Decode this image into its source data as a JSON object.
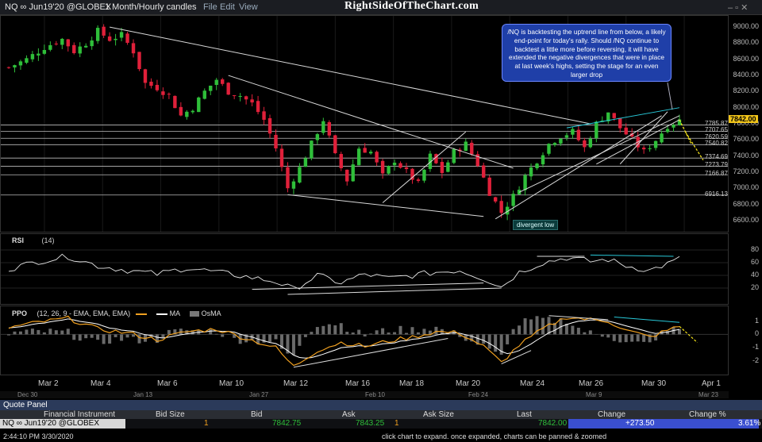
{
  "window": {
    "title": "NQ ∞ Jun19'20 @GLOBEX",
    "interval": "1 Month/Hourly candles",
    "menu": [
      "File",
      "Edit",
      "View"
    ],
    "watermark": "RightSideOfTheChart.com"
  },
  "callout": "/NQ is backtesting the uptrend line from below, a likely end-point for today's rally. Should /NQ continue to backtest a little more before reversing, it will have extended the negative divergences that were in place at last week's highs, setting the stage for an even larger drop",
  "annotation": "divergent low",
  "price_axis": [
    "9000.00",
    "8800.00",
    "8600.00",
    "8400.00",
    "8200.00",
    "8000.00",
    "7800.00",
    "7600.00",
    "7400.00",
    "7200.00",
    "7000.00",
    "6800.00",
    "6600.00"
  ],
  "levels": [
    "7785.87",
    "7707.65",
    "7620.59",
    "7540.82",
    "7374.69",
    "7273.79",
    "7166.87",
    "6916.13"
  ],
  "current_price": "7842.00",
  "rsi": {
    "label": "RSI",
    "param": "(14)",
    "axis": [
      "80",
      "60",
      "40",
      "20"
    ]
  },
  "ppo": {
    "label": "PPO",
    "param": "(12, 26, 9 - EMA, EMA, EMA)",
    "ma_label": "MA",
    "osma_label": "OsMA",
    "axis": [
      "1",
      "0",
      "-1",
      "-2"
    ]
  },
  "x_axis": [
    "Mar 2",
    "Mar 4",
    "Mar 6",
    "Mar 10",
    "Mar 12",
    "Mar 16",
    "Mar 18",
    "Mar 20",
    "Mar 24",
    "Mar 26",
    "Mar 30",
    "Apr 1"
  ],
  "date_bar": [
    "Dec 30",
    "Jan 13",
    "Jan 27",
    "Feb 10",
    "Feb 24",
    "Mar 9",
    "Mar 23"
  ],
  "quote_panel": {
    "title": "Quote Panel",
    "columns": [
      "Financial Instrument",
      "Bid Size",
      "Bid",
      "Ask",
      "Ask Size",
      "Last",
      "Change",
      "Change %"
    ],
    "row": {
      "instrument": "NQ ∞ Jun19'20 @GLOBEX",
      "bid_size": "1",
      "bid": "7842.75",
      "ask": "7843.25",
      "ask_size": "1",
      "last": "7842.00",
      "change": "+273.50",
      "change_pct": "3.61%"
    }
  },
  "status": {
    "time": "2:44:10 PM 3/30/2020",
    "hint": "click chart to expand. once expanded, charts can be panned & zoomed"
  },
  "colors": {
    "up": "#2fbf3a",
    "down": "#e0203a",
    "ppo": "#f0a020",
    "signal": "#ffffff",
    "trend": "#d8d8d8",
    "cyan": "#28c8d8",
    "yellow": "#f3e21a",
    "price_box": "#f0c419"
  },
  "chart_data": {
    "type": "candlestick",
    "ylim": [
      6500,
      9100
    ],
    "close_path": [
      [
        0,
        8500
      ],
      [
        3,
        8600
      ],
      [
        6,
        8750
      ],
      [
        9,
        8850
      ],
      [
        11,
        8700
      ],
      [
        13,
        8800
      ],
      [
        15,
        8950
      ],
      [
        17,
        8850
      ],
      [
        19,
        8900
      ],
      [
        21,
        8700
      ],
      [
        23,
        8300
      ],
      [
        25,
        8250
      ],
      [
        27,
        8150
      ],
      [
        29,
        7900
      ],
      [
        31,
        8000
      ],
      [
        33,
        8200
      ],
      [
        35,
        8350
      ],
      [
        37,
        8200
      ],
      [
        39,
        8150
      ],
      [
        41,
        8050
      ],
      [
        43,
        7850
      ],
      [
        45,
        7500
      ],
      [
        47,
        7000
      ],
      [
        49,
        7250
      ],
      [
        51,
        7550
      ],
      [
        53,
        7850
      ],
      [
        55,
        7400
      ],
      [
        57,
        7100
      ],
      [
        59,
        7500
      ],
      [
        61,
        7450
      ],
      [
        63,
        7150
      ],
      [
        65,
        7350
      ],
      [
        67,
        7200
      ],
      [
        69,
        7050
      ],
      [
        71,
        7400
      ],
      [
        73,
        7200
      ],
      [
        75,
        7450
      ],
      [
        77,
        7550
      ],
      [
        79,
        7300
      ],
      [
        81,
        6950
      ],
      [
        83,
        6700
      ],
      [
        85,
        6900
      ],
      [
        87,
        7150
      ],
      [
        89,
        7350
      ],
      [
        91,
        7550
      ],
      [
        93,
        7650
      ],
      [
        95,
        7700
      ],
      [
        97,
        7500
      ],
      [
        99,
        7800
      ],
      [
        101,
        7950
      ],
      [
        103,
        7750
      ],
      [
        105,
        7600
      ],
      [
        107,
        7450
      ],
      [
        109,
        7600
      ],
      [
        111,
        7780
      ],
      [
        113,
        7842
      ]
    ],
    "rsi_path": [
      [
        0,
        50
      ],
      [
        5,
        62
      ],
      [
        10,
        70
      ],
      [
        15,
        55
      ],
      [
        20,
        48
      ],
      [
        25,
        42
      ],
      [
        30,
        52
      ],
      [
        35,
        45
      ],
      [
        40,
        38
      ],
      [
        45,
        30
      ],
      [
        48,
        18
      ],
      [
        52,
        40
      ],
      [
        56,
        28
      ],
      [
        60,
        42
      ],
      [
        64,
        35
      ],
      [
        68,
        40
      ],
      [
        72,
        45
      ],
      [
        76,
        48
      ],
      [
        80,
        35
      ],
      [
        83,
        22
      ],
      [
        86,
        45
      ],
      [
        90,
        60
      ],
      [
        94,
        68
      ],
      [
        98,
        62
      ],
      [
        101,
        65
      ],
      [
        104,
        55
      ],
      [
        108,
        48
      ],
      [
        111,
        58
      ],
      [
        113,
        66
      ]
    ],
    "ppo_path": [
      [
        0,
        0.5
      ],
      [
        5,
        0.9
      ],
      [
        10,
        1.2
      ],
      [
        15,
        0.4
      ],
      [
        20,
        0.1
      ],
      [
        25,
        -0.4
      ],
      [
        30,
        0.2
      ],
      [
        35,
        0.4
      ],
      [
        40,
        -0.3
      ],
      [
        45,
        -1.0
      ],
      [
        48,
        -2.4
      ],
      [
        52,
        -1.2
      ],
      [
        56,
        -0.6
      ],
      [
        60,
        -0.9
      ],
      [
        64,
        -0.5
      ],
      [
        68,
        -0.2
      ],
      [
        72,
        0.2
      ],
      [
        76,
        0.1
      ],
      [
        80,
        -0.9
      ],
      [
        83,
        -2.1
      ],
      [
        86,
        -0.8
      ],
      [
        90,
        0.4
      ],
      [
        94,
        1.3
      ],
      [
        98,
        1.1
      ],
      [
        101,
        1.0
      ],
      [
        104,
        0.3
      ],
      [
        108,
        -0.2
      ],
      [
        111,
        0.3
      ],
      [
        113,
        0.6
      ]
    ]
  }
}
